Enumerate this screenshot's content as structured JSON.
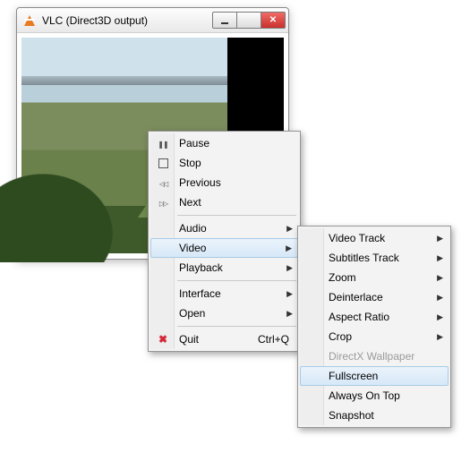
{
  "window": {
    "title": "VLC (Direct3D output)"
  },
  "menu": {
    "pause": "Pause",
    "stop": "Stop",
    "previous": "Previous",
    "next": "Next",
    "audio": "Audio",
    "video": "Video",
    "playback": "Playback",
    "interface": "Interface",
    "open": "Open",
    "quit": "Quit",
    "quit_accel": "Ctrl+Q"
  },
  "submenu": {
    "video_track": "Video Track",
    "subtitles_track": "Subtitles Track",
    "zoom": "Zoom",
    "deinterlace": "Deinterlace",
    "aspect_ratio": "Aspect Ratio",
    "crop": "Crop",
    "directx_wallpaper": "DirectX Wallpaper",
    "fullscreen": "Fullscreen",
    "always_on_top": "Always On Top",
    "snapshot": "Snapshot"
  }
}
